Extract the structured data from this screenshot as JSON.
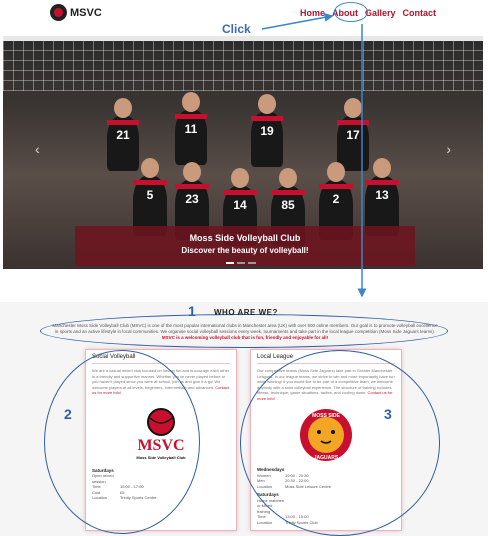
{
  "nav": {
    "logo_text": "MSVC",
    "links": [
      "Home",
      "About",
      "Gallery",
      "Contact"
    ]
  },
  "annotation": {
    "click_label": "Click",
    "numbers": [
      "1",
      "2",
      "3"
    ]
  },
  "hero": {
    "caption_title": "Moss Side Volleyball Club",
    "caption_subtitle": "Discover the beauty of volleyball!",
    "prev_icon": "‹",
    "next_icon": "›",
    "jersey_numbers": [
      "21",
      "11",
      "19",
      "17",
      "5",
      "23",
      "14",
      "85",
      "2",
      "13"
    ]
  },
  "about": {
    "title": "WHO ARE WE?",
    "text": "Manchester Moss Side Volleyball Club (MSVC) is one of the most popular international clubs in Manchester area (UK) with over 500 online members. Our goal is to promote volleyball excellence in sports and an active lifestyle in local communities. We organise social volleyball sessions every week, tournaments and take part in the local league competition (Moss Side Jaguars teams).",
    "text_em": "MSVC is a welcoming volleyball club that is fun, friendly and enjoyable for all!"
  },
  "social": {
    "title": "Social Volleyball",
    "desc": "We are a casual mixed club focused on having fun and encourage each other in a friendly and supportive manner. Whether you've never played before or you haven't played since you were at school, join us and give it a go! We welcome players at all levels, beginners, intermediate and advanced.",
    "more": "Contact us for more info!",
    "emblem_text": "MSVC",
    "emblem_sub": "Moss Side Volleyball Club",
    "schedule_heading": "Saturdays",
    "rows": [
      {
        "k": "Open mixed session",
        "v": ""
      },
      {
        "k": "Time",
        "v": "15:00 - 17:00"
      },
      {
        "k": "Cost",
        "v": "£5"
      },
      {
        "k": "Location",
        "v": "Trinity Sports Centre"
      }
    ]
  },
  "league": {
    "title": "Local League",
    "desc": "Our competitive teams (Moss Side Jaguars) take part in Greater Manchester Leagues. In our league teams, we strive to win and more importantly have fun while winning! If you would like to be part of a competitive team, we welcome anybody with a solid volleyball experience. The structure of training includes fitness, technique, game situations, tactics, and cooling down.",
    "more": "Contact us for more info!",
    "emblem_top": "MOSS SIDE",
    "emblem_bottom": "JAGUARS",
    "schedule_heading": "Wednesdays",
    "rows": [
      {
        "k": "Women",
        "v": "19:00 - 20:30"
      },
      {
        "k": "Men",
        "v": "20:30 - 22:00"
      },
      {
        "k": "Location",
        "v": "Moss Side Leisure Centre"
      }
    ],
    "schedule_heading2": "Saturdays",
    "rows2": [
      {
        "k": "Home matches or Mixed training",
        "v": ""
      },
      {
        "k": "Time",
        "v": "13:00 - 15:00"
      },
      {
        "k": "Location",
        "v": "Trinity Sports Club"
      }
    ]
  },
  "colors": {
    "brand_red": "#c8102e",
    "annotation_blue": "#2f5fa6"
  }
}
